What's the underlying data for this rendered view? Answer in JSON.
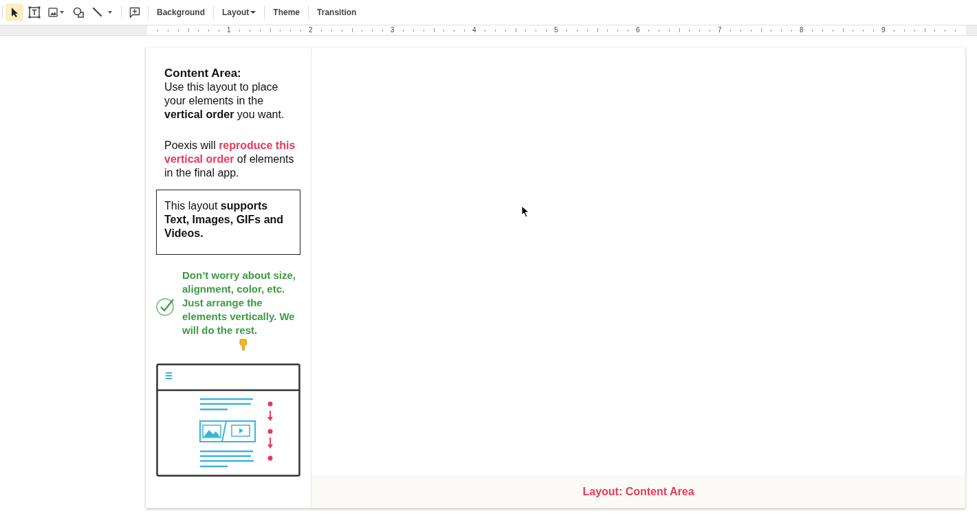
{
  "toolbar": {
    "tools": [
      {
        "kind": "select",
        "selected": true
      },
      {
        "kind": "textbox",
        "selected": false
      },
      {
        "kind": "image",
        "selected": false
      },
      {
        "kind": "shape",
        "selected": false
      },
      {
        "kind": "line",
        "selected": false
      },
      {
        "kind": "comment",
        "selected": false
      }
    ],
    "buttons": [
      {
        "label": "Background",
        "dropdown": false
      },
      {
        "label": "Layout",
        "dropdown": true
      },
      {
        "label": "Theme",
        "dropdown": false
      },
      {
        "label": "Transition",
        "dropdown": false
      }
    ]
  },
  "ruler": {
    "labels": [
      "1",
      "2",
      "3",
      "4",
      "5",
      "6",
      "7",
      "8",
      "9"
    ]
  },
  "slide": {
    "sidebar": {
      "heading": "Content Area:",
      "intro": "Use this layout to place your elements in the **vertical order** you want.",
      "note": [
        {
          "text": "Poexis will ",
          "highlight": false
        },
        {
          "text": "reproduce this vertical order",
          "highlight": true
        },
        {
          "text": " of elements in the final app.",
          "highlight": false
        }
      ],
      "boxed": "This layout **supports Text, Images, GIFs and Videos.**",
      "tip": "Don’t worry about size, alignment, color, etc. Just arrange the elements vertically. We will do the rest."
    },
    "footer": "Layout: Content Area"
  }
}
